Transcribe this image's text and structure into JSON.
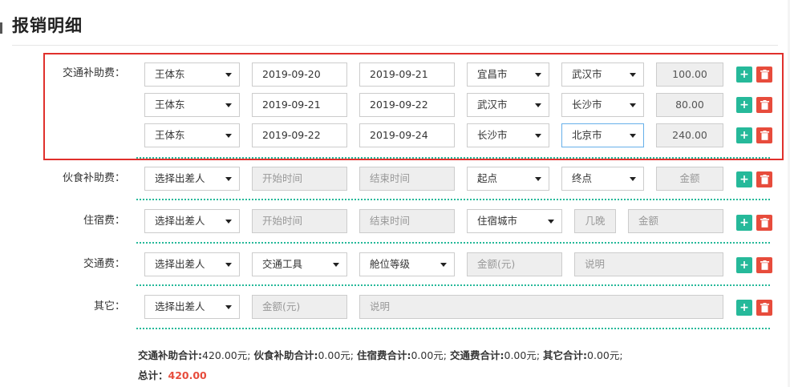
{
  "page_title": "报销明细",
  "traffic_subsidy": {
    "label": "交通补助费：",
    "rows": [
      {
        "person": "王体东",
        "start": "2019-09-20",
        "end": "2019-09-21",
        "from": "宜昌市",
        "to": "武汉市",
        "amount": "100.00"
      },
      {
        "person": "王体东",
        "start": "2019-09-21",
        "end": "2019-09-22",
        "from": "武汉市",
        "to": "长沙市",
        "amount": "80.00"
      },
      {
        "person": "王体东",
        "start": "2019-09-22",
        "end": "2019-09-24",
        "from": "长沙市",
        "to": "北京市",
        "amount": "240.00"
      }
    ]
  },
  "meal_subsidy": {
    "label": "伙食补助费：",
    "person_placeholder": "选择出差人",
    "start_placeholder": "开始时间",
    "end_placeholder": "结束时间",
    "from_placeholder": "起点",
    "to_placeholder": "终点",
    "amount_placeholder": "金额"
  },
  "lodging": {
    "label": "住宿费：",
    "person_placeholder": "选择出差人",
    "start_placeholder": "开始时间",
    "end_placeholder": "结束时间",
    "city_placeholder": "住宿城市",
    "nights_placeholder": "几晚",
    "amount_placeholder": "金额"
  },
  "transport": {
    "label": "交通费：",
    "person_placeholder": "选择出差人",
    "tool_placeholder": "交通工具",
    "class_placeholder": "舱位等级",
    "amount_placeholder": "金额(元)",
    "note_placeholder": "说明"
  },
  "other": {
    "label": "其它：",
    "person_placeholder": "选择出差人",
    "amount_placeholder": "金额(元)",
    "note_placeholder": "说明"
  },
  "buttons": {
    "add": "+"
  },
  "summary": {
    "traffic_subsidy_label": "交通补助合计:",
    "traffic_subsidy_value": "420.00元;",
    "meal_label": "伙食补助合计:",
    "meal_value": "0.00元;",
    "lodging_label": "住宿费合计:",
    "lodging_value": "0.00元;",
    "transport_label": "交通费合计:",
    "transport_value": "0.00元;",
    "other_label": "其它合计:",
    "other_value": "0.00元;",
    "total_label": "总计：",
    "total_value": "420.00"
  },
  "colors": {
    "add": "#26b99a",
    "delete": "#e74c3c",
    "highlight_box": "#e0302c"
  }
}
